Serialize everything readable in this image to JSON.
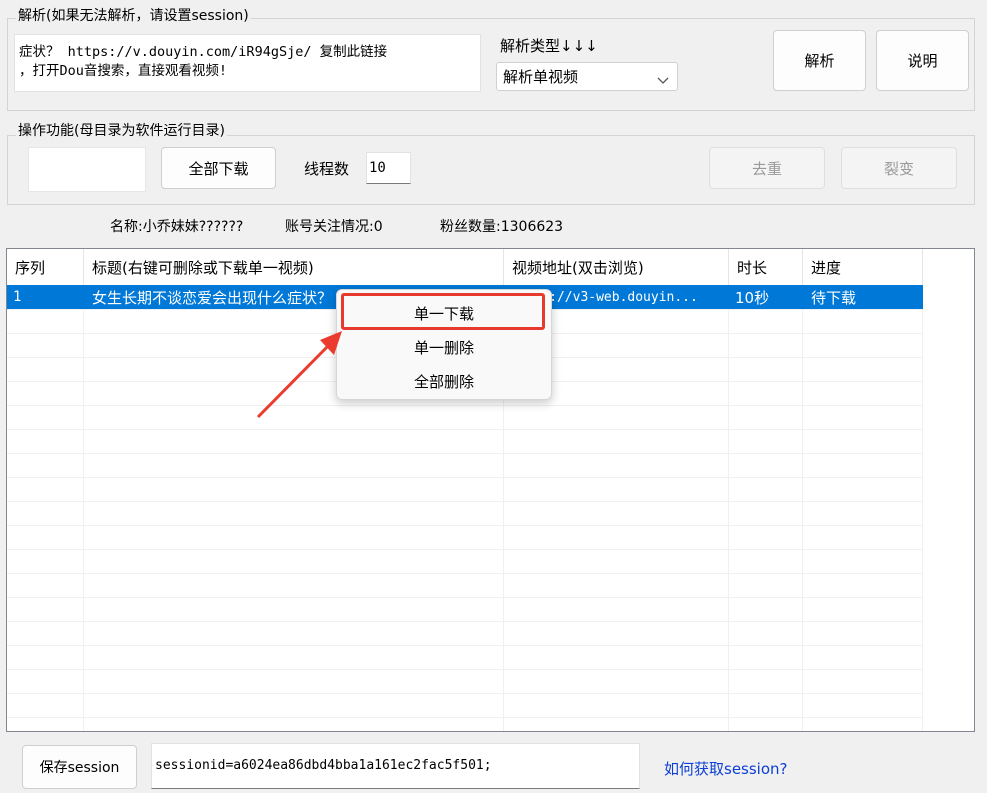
{
  "parse_group": {
    "legend": "解析(如果无法解析，请设置session)",
    "share_text_line1": "症状？ https://v.douyin.com/iR94gSje/ 复制此链接",
    "share_text_line2": "，打开Dou音搜索，直接观看视频!",
    "type_label": "解析类型↓↓↓",
    "type_selected": "解析单视频",
    "parse_button": "解析",
    "help_button": "说明"
  },
  "ops_group": {
    "legend": "操作功能(母目录为软件运行目录)",
    "download_all_button": "全部下载",
    "threads_label": "线程数",
    "threads_value": "10",
    "dedupe_button": "去重",
    "fission_button": "裂变"
  },
  "account_info": {
    "name_label": "名称:小乔妹妹??????",
    "follow_label": "账号关注情况:0",
    "fans_label": "粉丝数量:1306623"
  },
  "table": {
    "columns": [
      "序列",
      "标题(右键可删除或下载单一视频)",
      "视频地址(双击浏览)",
      "时长",
      "进度"
    ],
    "rows": [
      {
        "index": "1",
        "title": "女生长期不谈恋爱会出现什么症状？",
        "url": "https://v3-web.douyin...",
        "duration": "10秒",
        "progress": "待下载"
      }
    ]
  },
  "context_menu": {
    "items": [
      "单一下载",
      "单一删除",
      "全部删除"
    ]
  },
  "footer": {
    "save_session_button": "保存session",
    "session_value": "sessionid=a6024ea86dbd4bba1a161ec2fac5f501;",
    "how_to_link": "如何获取session?"
  },
  "colors": {
    "selection": "#0078d7",
    "annotation_red": "#e8392f",
    "link": "#0b3fd6"
  },
  "icons": {
    "dropdown": "chevron-down-icon",
    "annotation_arrow": "red-arrow-icon"
  }
}
